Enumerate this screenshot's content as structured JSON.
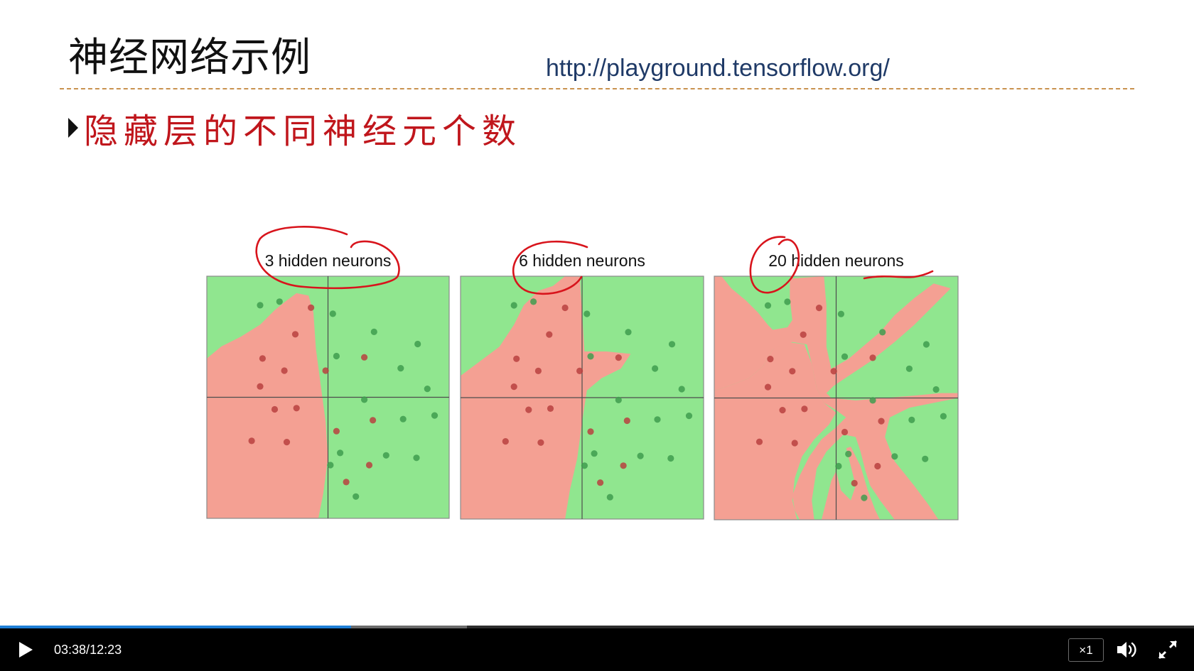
{
  "slide": {
    "title": "神经网络示例",
    "url": "http://playground.tensorflow.org/",
    "bullet": "隐藏层的不同神经元个数"
  },
  "panels": [
    {
      "title": "3 hidden neurons",
      "green_points": [
        [
          -0.56,
          0.76
        ],
        [
          -0.4,
          0.79
        ],
        [
          0.04,
          0.69
        ],
        [
          0.38,
          0.54
        ],
        [
          0.74,
          0.44
        ],
        [
          0.6,
          0.24
        ],
        [
          0.82,
          0.07
        ],
        [
          0.07,
          0.34
        ],
        [
          0.3,
          -0.02
        ],
        [
          0.62,
          -0.18
        ],
        [
          0.88,
          -0.15
        ],
        [
          0.48,
          -0.48
        ],
        [
          0.1,
          -0.46
        ],
        [
          0.02,
          -0.56
        ],
        [
          0.73,
          -0.5
        ],
        [
          0.23,
          -0.82
        ]
      ],
      "red_points": [
        [
          -0.14,
          0.74
        ],
        [
          -0.27,
          0.52
        ],
        [
          -0.54,
          0.32
        ],
        [
          -0.36,
          0.22
        ],
        [
          -0.56,
          0.09
        ],
        [
          -0.02,
          0.22
        ],
        [
          0.3,
          0.33
        ],
        [
          -0.44,
          -0.1
        ],
        [
          -0.26,
          -0.09
        ],
        [
          0.37,
          -0.19
        ],
        [
          0.07,
          -0.28
        ],
        [
          -0.63,
          -0.36
        ],
        [
          -0.34,
          -0.37
        ],
        [
          0.34,
          -0.56
        ],
        [
          0.15,
          -0.7
        ]
      ]
    },
    {
      "title": "6 hidden neurons",
      "green_points": [
        [
          -0.56,
          0.76
        ],
        [
          -0.4,
          0.79
        ],
        [
          0.04,
          0.69
        ],
        [
          0.38,
          0.54
        ],
        [
          0.74,
          0.44
        ],
        [
          0.6,
          0.24
        ],
        [
          0.82,
          0.07
        ],
        [
          0.07,
          0.34
        ],
        [
          0.3,
          -0.02
        ],
        [
          0.62,
          -0.18
        ],
        [
          0.88,
          -0.15
        ],
        [
          0.48,
          -0.48
        ],
        [
          0.1,
          -0.46
        ],
        [
          0.02,
          -0.56
        ],
        [
          0.73,
          -0.5
        ],
        [
          0.23,
          -0.82
        ]
      ],
      "red_points": [
        [
          -0.14,
          0.74
        ],
        [
          -0.27,
          0.52
        ],
        [
          -0.54,
          0.32
        ],
        [
          -0.36,
          0.22
        ],
        [
          -0.56,
          0.09
        ],
        [
          -0.02,
          0.22
        ],
        [
          0.3,
          0.33
        ],
        [
          -0.44,
          -0.1
        ],
        [
          -0.26,
          -0.09
        ],
        [
          0.37,
          -0.19
        ],
        [
          0.07,
          -0.28
        ],
        [
          -0.63,
          -0.36
        ],
        [
          -0.34,
          -0.37
        ],
        [
          0.34,
          -0.56
        ],
        [
          0.15,
          -0.7
        ]
      ]
    },
    {
      "title": "20 hidden neurons",
      "green_points": [
        [
          -0.56,
          0.76
        ],
        [
          -0.4,
          0.79
        ],
        [
          0.04,
          0.69
        ],
        [
          0.38,
          0.54
        ],
        [
          0.74,
          0.44
        ],
        [
          0.6,
          0.24
        ],
        [
          0.82,
          0.07
        ],
        [
          0.07,
          0.34
        ],
        [
          0.3,
          -0.02
        ],
        [
          0.62,
          -0.18
        ],
        [
          0.88,
          -0.15
        ],
        [
          0.48,
          -0.48
        ],
        [
          0.1,
          -0.46
        ],
        [
          0.02,
          -0.56
        ],
        [
          0.73,
          -0.5
        ],
        [
          0.23,
          -0.82
        ]
      ],
      "red_points": [
        [
          -0.14,
          0.74
        ],
        [
          -0.27,
          0.52
        ],
        [
          -0.54,
          0.32
        ],
        [
          -0.36,
          0.22
        ],
        [
          -0.56,
          0.09
        ],
        [
          -0.02,
          0.22
        ],
        [
          0.3,
          0.33
        ],
        [
          -0.44,
          -0.1
        ],
        [
          -0.26,
          -0.09
        ],
        [
          0.37,
          -0.19
        ],
        [
          0.07,
          -0.28
        ],
        [
          -0.63,
          -0.36
        ],
        [
          -0.34,
          -0.37
        ],
        [
          0.34,
          -0.56
        ],
        [
          0.15,
          -0.7
        ]
      ]
    }
  ],
  "colors": {
    "region_green": "#90e68f",
    "region_red": "#f4a093",
    "point_green": "#3f9c4f",
    "point_red": "#b8413f",
    "axis": "#4d4d4d",
    "annotation": "#d8141c"
  },
  "player": {
    "current_time": "03:38",
    "separator": "/",
    "duration": "12:23",
    "played_fraction": 0.294,
    "buffered_fraction": 0.391,
    "speed_label": "×1",
    "icons": [
      "play-icon",
      "volume-icon",
      "fullscreen-icon"
    ]
  }
}
